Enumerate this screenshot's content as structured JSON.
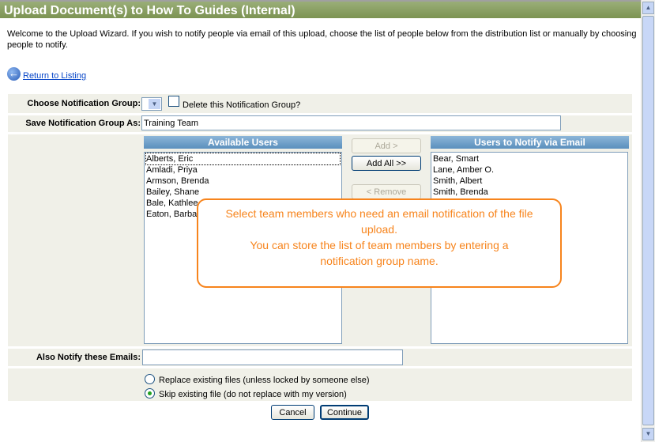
{
  "title": "Upload Document(s) to How To Guides (Internal)",
  "intro": "Welcome to the Upload Wizard. If you wish to notify people via email of this upload, choose the list of people below from the distribution list or manually by choosing people to notify.",
  "return_link": "Return to Listing",
  "choose_group_label": "Choose Notification Group:",
  "delete_group_label": "Delete this Notification Group?",
  "save_group_label": "Save Notification Group As:",
  "save_group_value": "Training Team",
  "available_header": "Available Users",
  "available_users": [
    "Alberts, Eric",
    "Amladi, Priya",
    "Armson, Brenda",
    "Bailey, Shane",
    "Bale, Kathlee",
    "Eaton, Barba"
  ],
  "notify_header": "Users to Notify via Email",
  "notify_users": [
    "Bear, Smart",
    "Lane, Amber O.",
    "Smith, Albert",
    "Smith, Brenda"
  ],
  "add_label": "Add >",
  "add_all_label": "Add All >>",
  "remove_label": "< Remove",
  "also_notify_label": "Also Notify these Emails:",
  "also_notify_value": "",
  "radio_replace": "Replace existing files (unless locked by someone else)",
  "radio_skip": "Skip existing file (do not replace with my version)",
  "cancel_label": "Cancel",
  "continue_label": "Continue",
  "callout_line1": "Select team members who need an email notification of the file upload.",
  "callout_line2": "You can store the list of team members by entering a notification group name."
}
